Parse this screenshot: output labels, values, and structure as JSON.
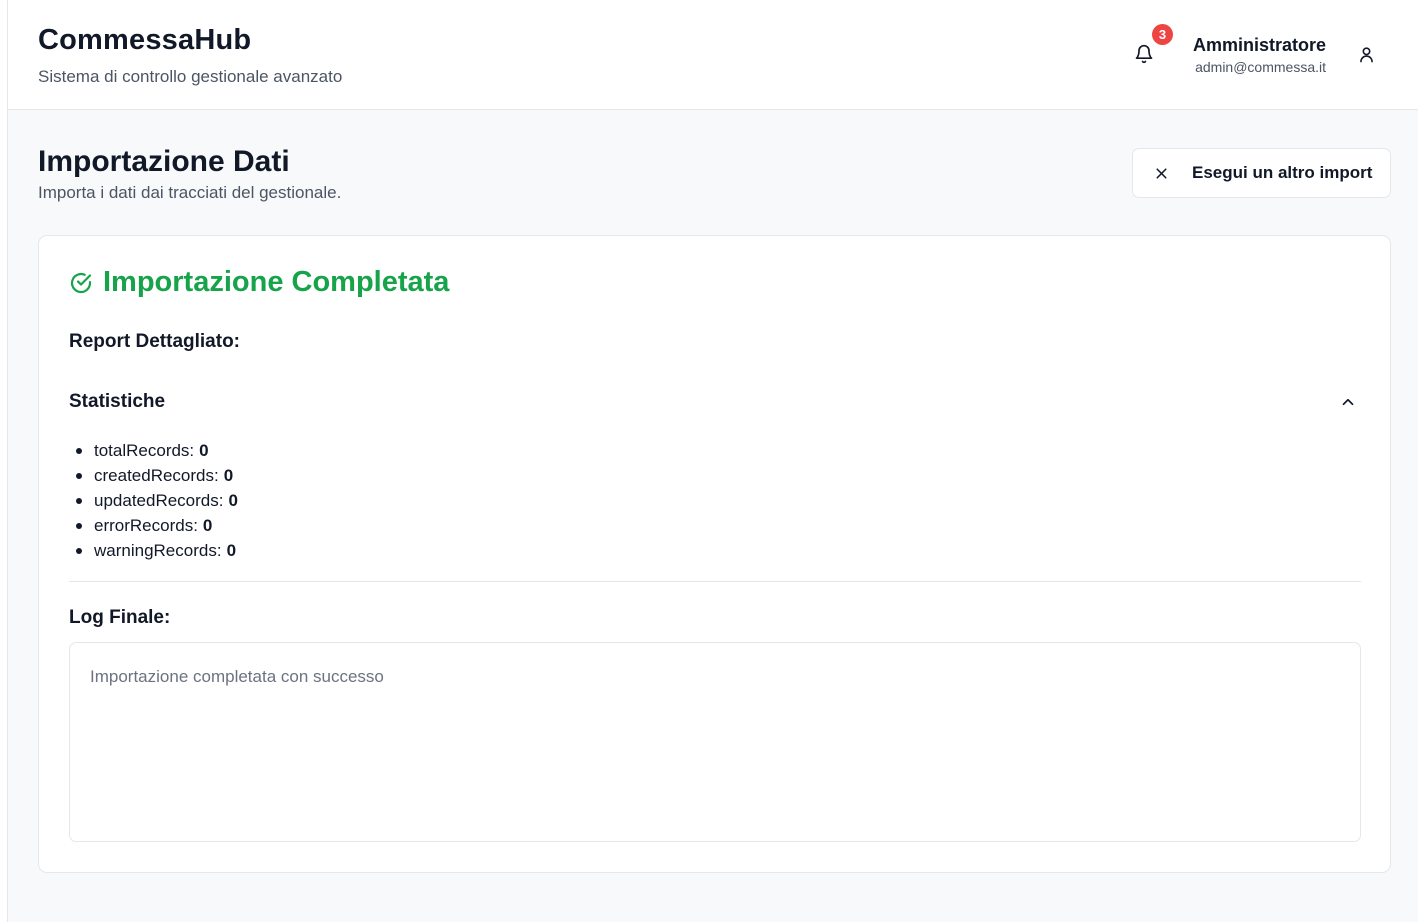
{
  "header": {
    "app_title": "CommessaHub",
    "app_subtitle": "Sistema di controllo gestionale avanzato",
    "notifications": {
      "icon": "bell-icon",
      "count": "3",
      "badge_color": "#ef4444"
    },
    "user": {
      "name": "Amministratore",
      "email": "admin@commessa.it",
      "icon": "user-icon"
    }
  },
  "page": {
    "title": "Importazione Dati",
    "subtitle": "Importa i dati dai tracciati del gestionale.",
    "action_button": {
      "label": "Esegui un altro import",
      "icon": "close-icon"
    }
  },
  "result": {
    "title": "Importazione Completata",
    "status_icon": "check-circle-icon",
    "status_color": "#16a34a",
    "report_heading": "Report Dettagliato:",
    "stats": {
      "heading": "Statistiche",
      "toggle_icon": "chevron-up-icon",
      "items": [
        {
          "label": "totalRecords:",
          "value": "0"
        },
        {
          "label": "createdRecords:",
          "value": "0"
        },
        {
          "label": "updatedRecords:",
          "value": "0"
        },
        {
          "label": "errorRecords:",
          "value": "0"
        },
        {
          "label": "warningRecords:",
          "value": "0"
        }
      ]
    },
    "log_heading": "Log Finale:",
    "log_text": "Importazione completata con successo"
  }
}
